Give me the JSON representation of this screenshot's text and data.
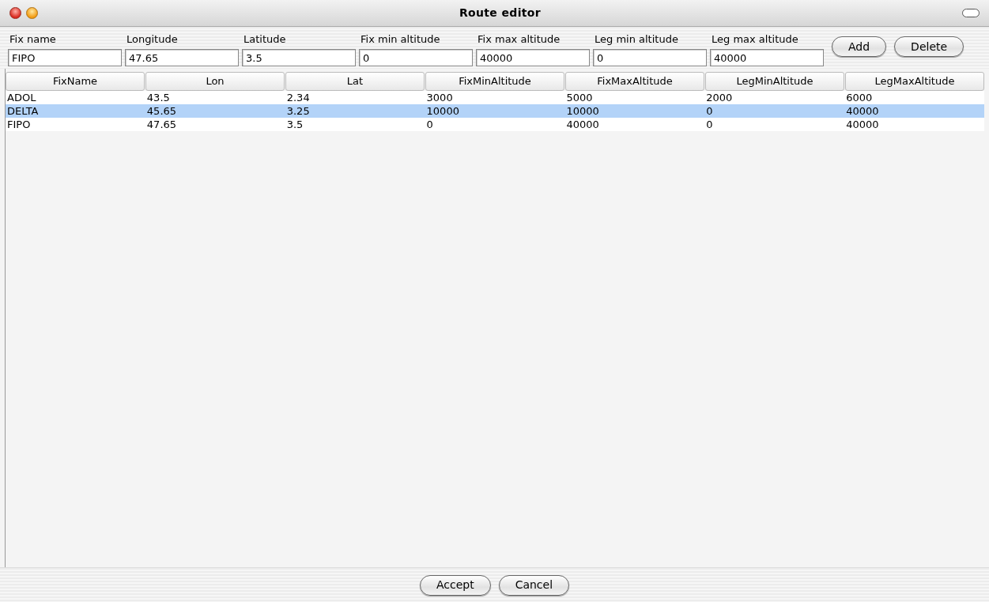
{
  "window": {
    "title": "Route editor"
  },
  "fields": [
    {
      "label": "Fix name",
      "value": "FIPO"
    },
    {
      "label": "Longitude",
      "value": "47.65"
    },
    {
      "label": "Latitude",
      "value": "3.5"
    },
    {
      "label": "Fix min altitude",
      "value": "0"
    },
    {
      "label": "Fix max altitude",
      "value": "40000"
    },
    {
      "label": "Leg min altitude",
      "value": "0"
    },
    {
      "label": "Leg max altitude",
      "value": "40000"
    }
  ],
  "form_buttons": [
    "Add",
    "Delete"
  ],
  "table": {
    "columns": [
      "FixName",
      "Lon",
      "Lat",
      "FixMinAltitude",
      "FixMaxAltitude",
      "LegMinAltitude",
      "LegMaxAltitude"
    ],
    "rows": [
      {
        "cells": [
          "ADOL",
          "43.5",
          "2.34",
          "3000",
          "5000",
          "2000",
          "6000"
        ],
        "selected": false
      },
      {
        "cells": [
          "DELTA",
          "45.65",
          "3.25",
          "10000",
          "10000",
          "0",
          "40000"
        ],
        "selected": true
      },
      {
        "cells": [
          "FIPO",
          "47.65",
          "3.5",
          "0",
          "40000",
          "0",
          "40000"
        ],
        "selected": false
      }
    ]
  },
  "footer_buttons": [
    "Accept",
    "Cancel"
  ]
}
